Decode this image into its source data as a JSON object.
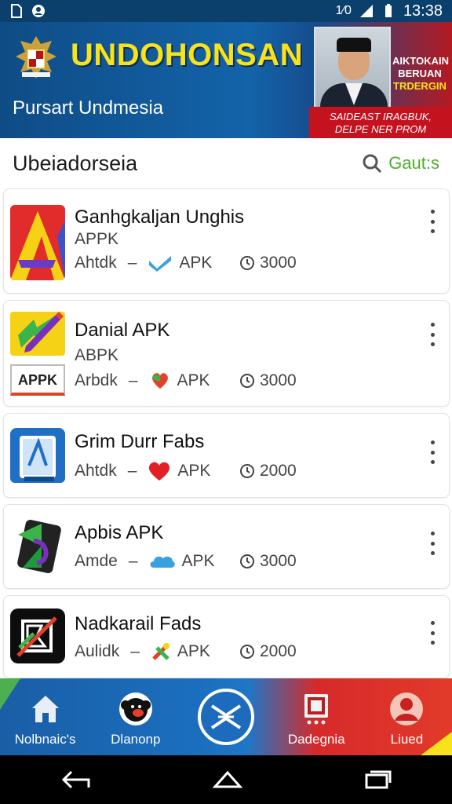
{
  "status_bar": {
    "time": "13:38",
    "network_label": "1⁄0",
    "left_icons": [
      "document-icon",
      "account-icon"
    ],
    "right_icons": [
      "signal-icon",
      "battery-icon"
    ]
  },
  "banner": {
    "brand": "UNDOHONSAN",
    "subtitle": "Pursart Undmesia",
    "promo_top": [
      "AIKTOKAIN",
      "BERUAN",
      "TRDERGIN"
    ],
    "promo_strip": [
      "SAIDEAST IRAGBUK,",
      "DELPE NER PROM"
    ],
    "colors": {
      "yellow": "#f8e21b",
      "blue": "#0f4c86",
      "red": "#c4121f"
    }
  },
  "section": {
    "title": "Ubeiadorseia",
    "search_label": "Gaut:s"
  },
  "apps": [
    {
      "name": "Ganhgkaljan Unghis",
      "type": "APPK",
      "author": "Ahtdk",
      "apk": "APK",
      "count": "3000",
      "badge_icon": "check-icon",
      "app_icon": "red-a-logo-icon"
    },
    {
      "name": "Danial APK",
      "type": "ABPK",
      "author": "Arbdk",
      "apk": "APK",
      "count": "3000",
      "badge_icon": "leaf-heart-icon",
      "app_icon": "apk-pen-logo-icon",
      "app_icon_text": "APPK"
    },
    {
      "name": "Grim Durr Fabs",
      "type": "",
      "author": "Ahtdk",
      "apk": "APK",
      "count": "2000",
      "badge_icon": "heart-icon",
      "app_icon": "blue-book-logo-icon"
    },
    {
      "name": "Apbis APK",
      "type": "",
      "author": "Amde",
      "apk": "APK",
      "count": "3000",
      "badge_icon": "cloud-icon",
      "app_icon": "green-phone-logo-icon"
    },
    {
      "name": "Nadkarail Fads",
      "type": "",
      "author": "Aulidk",
      "apk": "APK",
      "count": "2000",
      "badge_icon": "tool-icon",
      "app_icon": "black-b-logo-icon"
    }
  ],
  "bottom_nav": [
    {
      "label": "Nolbnaic's",
      "icon": "home-icon"
    },
    {
      "label": "Dlanonp",
      "icon": "monkey-icon"
    },
    {
      "label": "",
      "icon": "center-logo-icon"
    },
    {
      "label": "Dadegnia",
      "icon": "device-icon"
    },
    {
      "label": "Liued",
      "icon": "user-icon"
    }
  ],
  "system_nav": [
    "back-icon",
    "home-button-icon",
    "recents-icon"
  ]
}
